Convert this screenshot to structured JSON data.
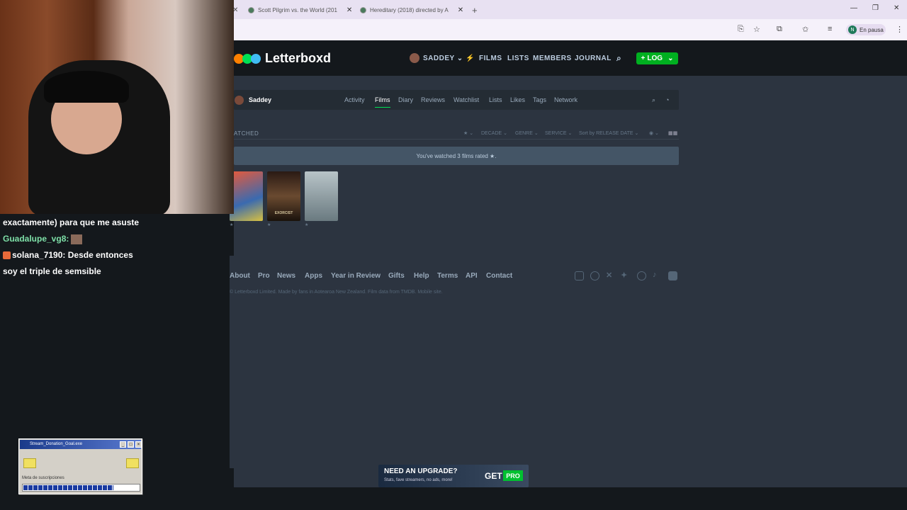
{
  "browser": {
    "tabs": [
      {
        "title": "Scott Pilgrim vs. the World (201"
      },
      {
        "title": "Hereditary (2018) directed by A"
      }
    ],
    "new_tab": "+",
    "profile_initial": "N",
    "profile_status": "En pausa"
  },
  "letterboxd": {
    "logo": "Letterboxd",
    "nav": {
      "user": "SADDEY",
      "films": "FILMS",
      "lists": "LISTS",
      "members": "MEMBERS",
      "journal": "JOURNAL",
      "log": "LOG"
    },
    "profile": {
      "name": "Saddey",
      "tabs": [
        "Activity",
        "Films",
        "Diary",
        "Reviews",
        "Watchlist",
        "Lists",
        "Likes",
        "Tags",
        "Network"
      ],
      "active_tab": "Films"
    },
    "section_label": "ATCHED",
    "filters": {
      "decade": "DECADE",
      "genre": "GENRE",
      "service": "SERVICE",
      "sort": "Sort by RELEASE DATE"
    },
    "notice": "You've watched 3 films rated ★.",
    "posters": [
      {
        "label": "",
        "color": "#c84a3a"
      },
      {
        "label": "EXORCIST",
        "color": "#3a2a20"
      },
      {
        "label": "",
        "color": "#8a9aa0"
      }
    ],
    "footer": {
      "links": [
        "About",
        "Pro",
        "News",
        "Apps",
        "Year in Review",
        "Gifts",
        "Help",
        "Terms",
        "API",
        "Contact"
      ],
      "copyright": "© Letterboxd Limited. Made by fans in Aotearoa New Zealand. Film data from TMDB. Mobile site."
    }
  },
  "chat": {
    "line1": "exactamente) para que me asuste",
    "user1": "Guadalupe_vg8:",
    "user2": "solana_7190:",
    "msg2a": "Desde entonces",
    "msg2b": "soy el triple de semsible"
  },
  "goal_widget": {
    "title": "Stream_Donation_Goal.exe",
    "label": "Meta de suscripciones",
    "progress": 0.78
  },
  "ad": {
    "headline": "NEED AN UPGRADE?",
    "sub": "Stats, fave streamers, no ads, more!",
    "cta": "GET",
    "badge": "PRO"
  }
}
